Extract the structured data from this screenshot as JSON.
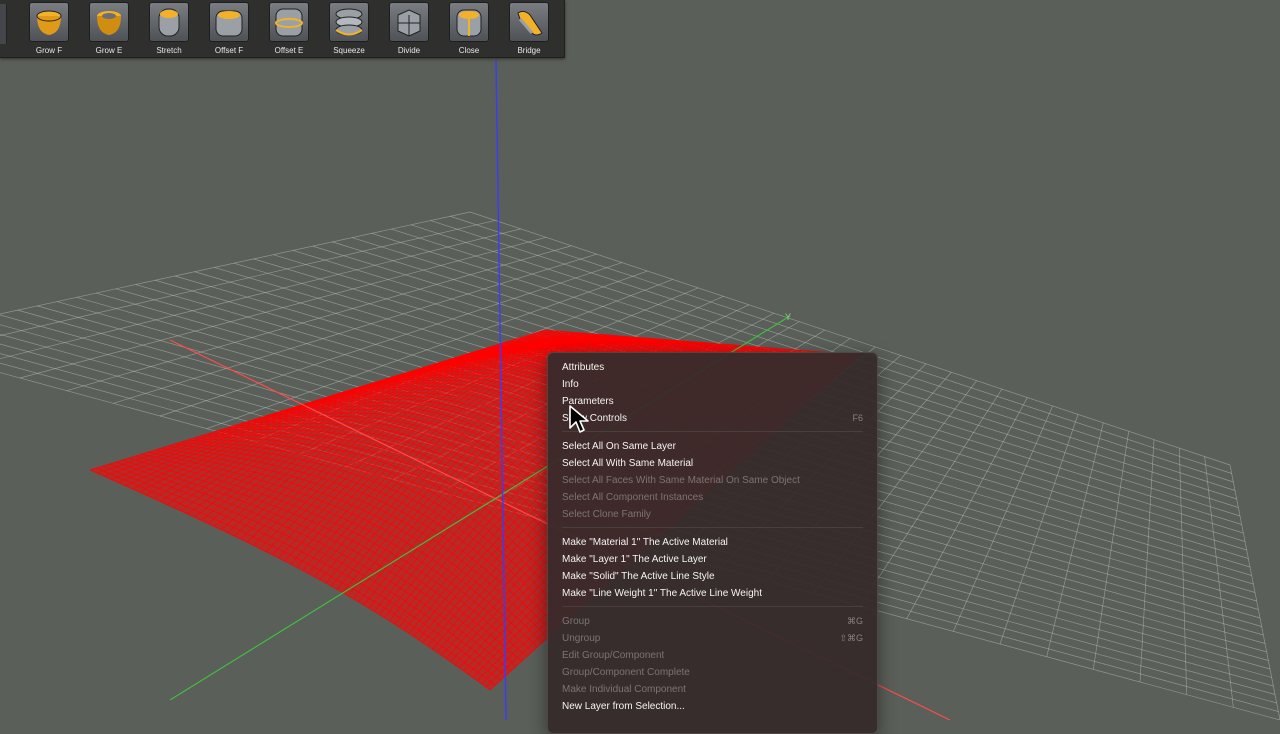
{
  "toolbar": {
    "tools": [
      {
        "label": "Grow F",
        "icon": "grow-face-icon"
      },
      {
        "label": "Grow E",
        "icon": "grow-edge-icon"
      },
      {
        "label": "Stretch",
        "icon": "stretch-icon"
      },
      {
        "label": "Offset F",
        "icon": "offset-face-icon"
      },
      {
        "label": "Offset E",
        "icon": "offset-edge-icon"
      },
      {
        "label": "Squeeze",
        "icon": "squeeze-icon"
      },
      {
        "label": "Divide",
        "icon": "divide-icon"
      },
      {
        "label": "Close",
        "icon": "close-icon"
      },
      {
        "label": "Bridge",
        "icon": "bridge-icon"
      }
    ]
  },
  "viewport": {
    "axis_label_y": "Y",
    "colors": {
      "background": "#5b5f59",
      "grid": "#bfc3bd",
      "surface": "#ff0000",
      "axis_x": "#ff4a4a",
      "axis_y": "#3fbf3f",
      "axis_z": "#3a3aff"
    }
  },
  "context_menu": {
    "items": {
      "attributes": "Attributes",
      "info": "Info",
      "parameters": "Parameters",
      "show_controls": "Show Controls",
      "show_controls_shortcut": "F6",
      "select_same_layer": "Select All On Same Layer",
      "select_same_material": "Select All With Same Material",
      "select_faces_same_material": "Select All Faces With Same Material On Same Object",
      "select_component_instances": "Select All Component Instances",
      "select_clone_family": "Select Clone Family",
      "make_material_active": "Make \"Material 1\" The Active Material",
      "make_layer_active": "Make \"Layer 1\" The Active Layer",
      "make_solid_active": "Make \"Solid\" The Active Line Style",
      "make_line_weight_active": "Make \"Line Weight 1\" The Active Line Weight",
      "group": "Group",
      "group_shortcut": "⌘G",
      "ungroup": "Ungroup",
      "ungroup_shortcut": "⇧⌘G",
      "edit_group": "Edit Group/Component",
      "group_complete": "Group/Component Complete",
      "make_individual": "Make Individual Component",
      "new_layer": "New Layer from Selection..."
    }
  }
}
